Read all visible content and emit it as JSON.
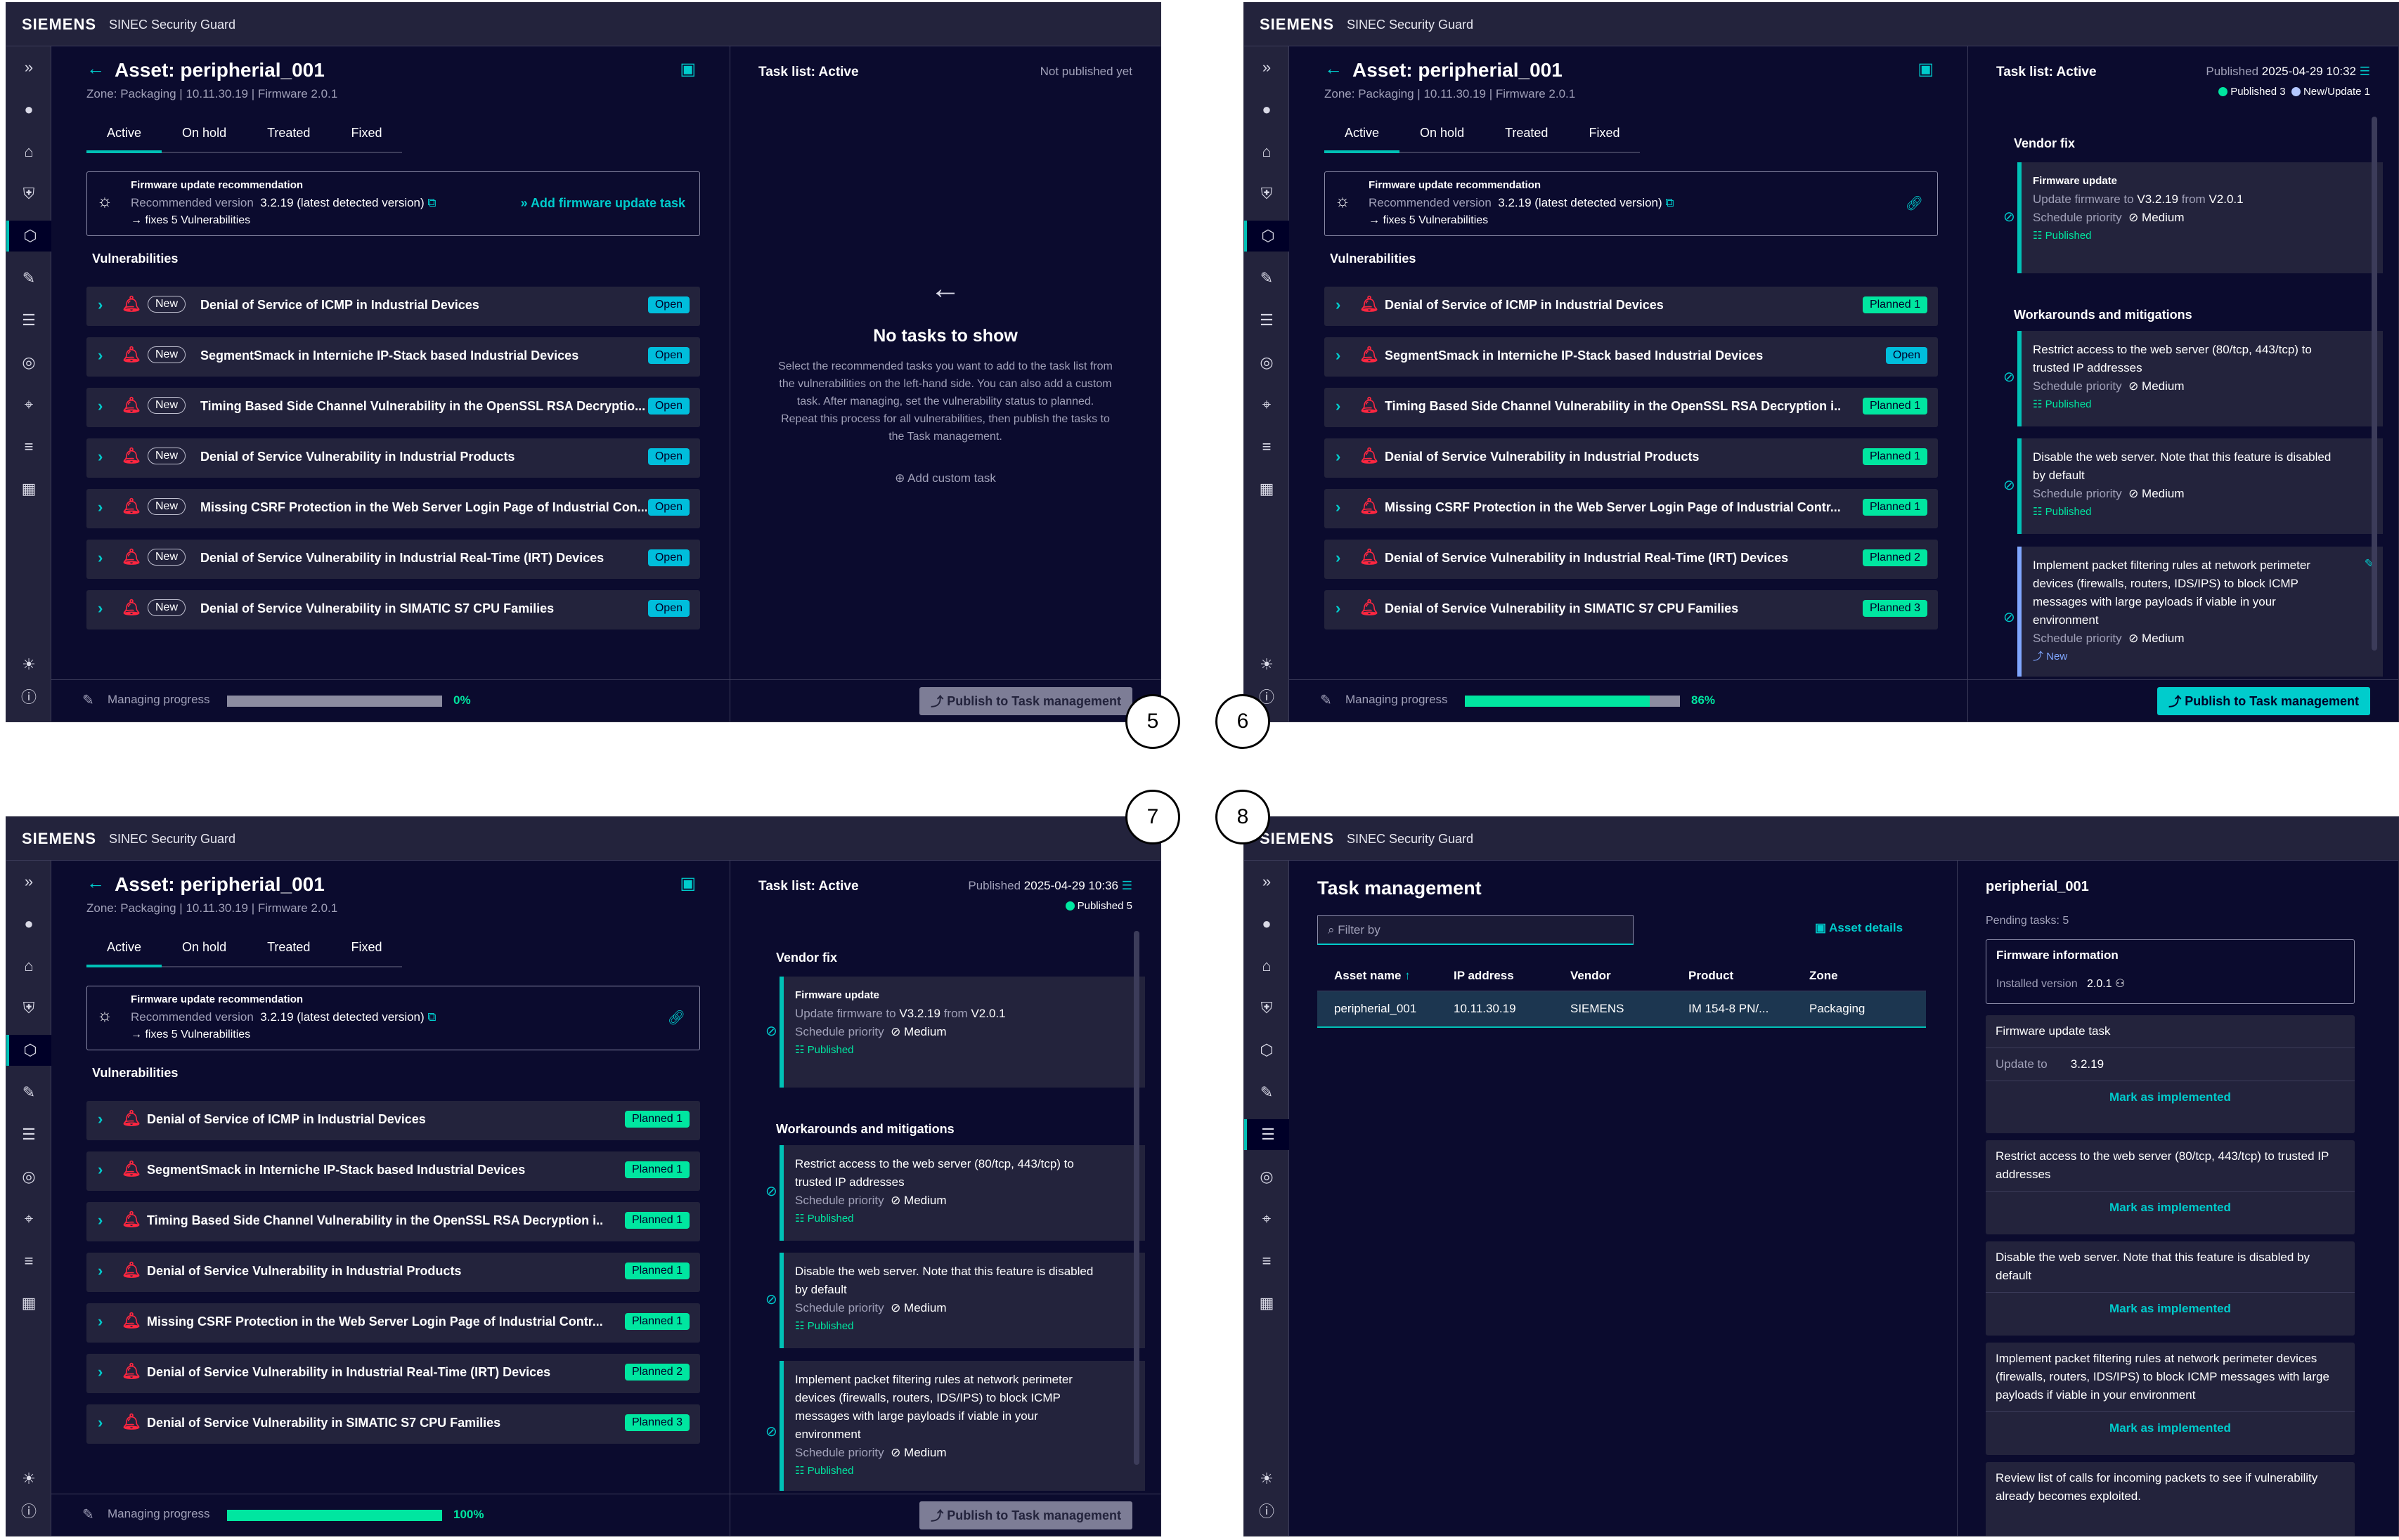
{
  "app": {
    "brand": "SIEMENS",
    "name": "SINEC Security Guard"
  },
  "asset": {
    "title": "Asset: peripherial_001",
    "sub": "Zone: Packaging | 10.11.30.19 | Firmware 2.0.1"
  },
  "tabs": [
    "Active",
    "On hold",
    "Treated",
    "Fixed"
  ],
  "fw": {
    "title": "Firmware update recommendation",
    "rec_label": "Recommended version",
    "rec_value": "3.2.19 (latest detected version)",
    "fixes": "→ fixes 5 Vulnerabilities",
    "add": "Add firmware update task"
  },
  "vuln_heading": "Vulnerabilities",
  "new_label": "New",
  "vulns": [
    {
      "name": "Denial of Service of ICMP in Industrial Devices",
      "short": "Denial of Service of ICMP in Industrial Devices",
      "status_open": "Open",
      "planned": "Planned 1"
    },
    {
      "name": "SegmentSmack in Interniche IP-Stack based Industrial Devices",
      "short": "SegmentSmack in Interniche IP-Stack based Industrial Devices",
      "status_open": "Open",
      "planned": "Planned 1"
    },
    {
      "name": "Timing Based Side Channel Vulnerability in the OpenSSL RSA Decryptio...",
      "short": "Timing Based Side Channel Vulnerability in the OpenSSL RSA Decryption i...",
      "status_open": "Open",
      "planned": "Planned 1"
    },
    {
      "name": "Denial of Service Vulnerability in Industrial Products",
      "short": "Denial of Service Vulnerability in Industrial Products",
      "status_open": "Open",
      "planned": "Planned 1"
    },
    {
      "name": "Missing CSRF Protection in the Web Server Login Page of Industrial Con...",
      "short": "Missing CSRF Protection in the Web Server Login Page of Industrial Contr...",
      "status_open": "Open",
      "planned": "Planned 1"
    },
    {
      "name": "Denial of Service Vulnerability in Industrial Real-Time (IRT) Devices",
      "short": "Denial of Service Vulnerability in Industrial Real-Time (IRT) Devices",
      "status_open": "Open",
      "planned": "Planned 2"
    },
    {
      "name": "Denial of Service Vulnerability in SIMATIC S7 CPU Families",
      "short": "Denial of Service Vulnerability in SIMATIC S7 CPU Families",
      "status_open": "Open",
      "planned": "Planned 3"
    }
  ],
  "footer": {
    "label": "Managing progress",
    "publish": "Publish to Task management",
    "p5": "0%",
    "p6": "86%",
    "p7": "100%",
    "v5": 0,
    "v6": 0.86,
    "v7": 1.0
  },
  "tasklist": {
    "title": "Task list: Active",
    "not_published": "Not published yet",
    "pub_label": "Published",
    "pub6": "2025-04-29 10:32",
    "pub7": "2025-04-29 10:36",
    "leg_pub6": "Published 3",
    "leg_new6": "New/Update 1",
    "leg_pub7": "Published 5",
    "empty_title": "No tasks to show",
    "empty_text1": "Select the recommended tasks you want to add to the task list from",
    "empty_text2": "the vulnerabilities on the left-hand side. You can also add a custom",
    "empty_text3": "task. After managing, set the vulnerability status to planned.",
    "empty_text4": "Repeat this process for all vulnerabilities, then publish the tasks to",
    "empty_text5": "the Task management.",
    "add_custom": "Add custom task"
  },
  "sections": {
    "vendor": "Vendor fix",
    "work": "Workarounds and mitigations"
  },
  "cards": {
    "fw_title": "Firmware update",
    "fw_text_a": "Update firmware to",
    "fw_from": "V3.2.19",
    "fw_mid": "from",
    "fw_to": "V2.0.1",
    "sp": "Schedule priority",
    "prio": "Medium",
    "published": "Published",
    "new": "New",
    "t1a": "Restrict access to the web server (80/tcp, 443/tcp) to",
    "t1b": "trusted IP addresses",
    "t2a": "Disable the web server. Note that this feature is disabled",
    "t2b": "by default",
    "t3a": "Implement packet filtering rules at network perimeter",
    "t3b": "devices (firewalls, routers, IDS/IPS) to block ICMP",
    "t3c": "messages with large payloads if viable in your",
    "t3d": "environment"
  },
  "tm": {
    "title": "Task management",
    "filter": "Filter by",
    "asset_details": "Asset details",
    "cols": [
      "Asset name",
      "IP address",
      "Vendor",
      "Product",
      "Zone"
    ],
    "row": [
      "peripherial_001",
      "10.11.30.19",
      "SIEMENS",
      "IM 154-8 PN/...",
      "Packaging"
    ],
    "d_title": "peripherial_001",
    "pending": "Pending tasks: 5",
    "fi_title": "Firmware information",
    "inst_label": "Installed version",
    "inst_val": "2.0.1",
    "fwt": "Firmware update task",
    "upd_label": "Update to",
    "upd_val": "3.2.19",
    "mark": "Mark as implemented",
    "d1": "Restrict access to the web server (80/tcp, 443/tcp) to trusted IP",
    "d1b": "addresses",
    "d2": "Disable the web server. Note that this feature is disabled by",
    "d2b": "default",
    "d3": "Implement packet filtering rules at network perimeter devices",
    "d3b": "(firewalls, routers, IDS/IPS) to block ICMP messages with large",
    "d3c": "payloads if viable in your environment",
    "d4": "Review list of calls for incoming packets to see if vulnerability",
    "d4b": "already becomes exploited."
  },
  "steps": [
    "5",
    "6",
    "7",
    "8"
  ],
  "colors": {
    "accent": "#00c1b6",
    "open": "#00bedc",
    "planned": "#00e6a0",
    "bg": "#000028"
  }
}
